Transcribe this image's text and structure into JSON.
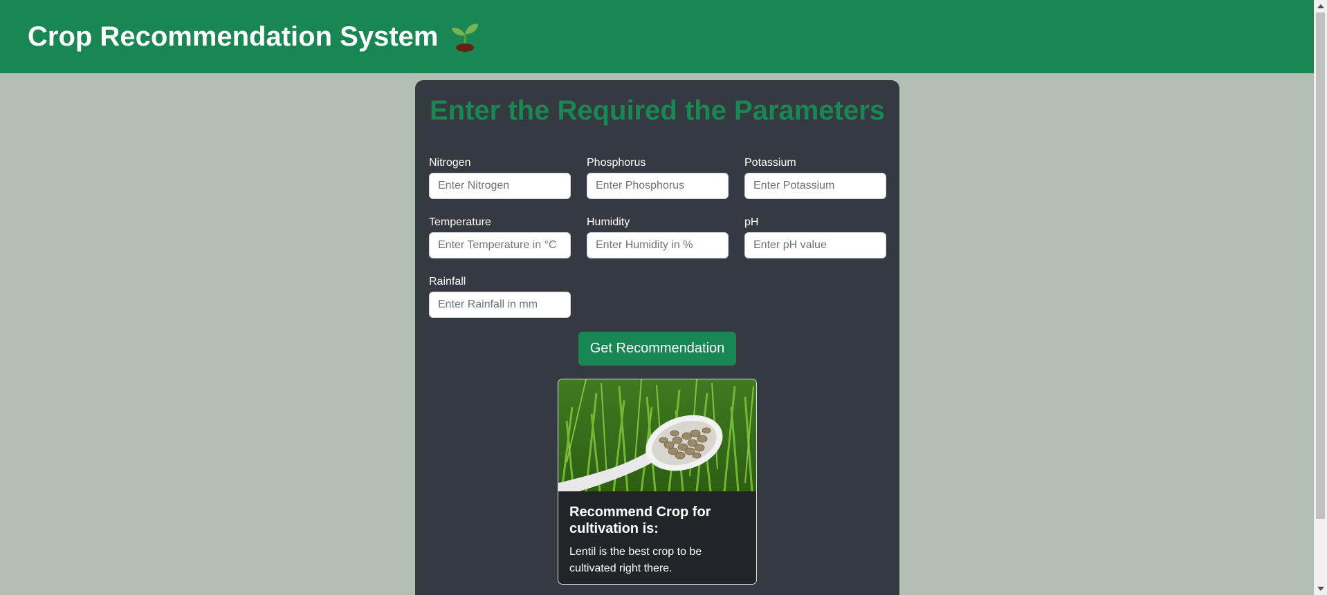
{
  "navbar": {
    "title": "Crop Recommendation System",
    "icon": "seedling-icon"
  },
  "form": {
    "heading": "Enter the Required the Parameters",
    "fields": [
      {
        "label": "Nitrogen",
        "placeholder": "Enter Nitrogen",
        "value": ""
      },
      {
        "label": "Phosphorus",
        "placeholder": "Enter Phosphorus",
        "value": ""
      },
      {
        "label": "Potassium",
        "placeholder": "Enter Potassium",
        "value": ""
      },
      {
        "label": "Temperature",
        "placeholder": "Enter Temperature in °C",
        "value": ""
      },
      {
        "label": "Humidity",
        "placeholder": "Enter Humidity in %",
        "value": ""
      },
      {
        "label": "pH",
        "placeholder": "Enter pH value",
        "value": ""
      },
      {
        "label": "Rainfall",
        "placeholder": "Enter Rainfall in mm",
        "value": ""
      }
    ],
    "submit_label": "Get Recommendation"
  },
  "result": {
    "image": "lentil-seeds-image",
    "title": "Recommend Crop for cultivation is:",
    "text": "Lentil is the best crop to be cultivated right there."
  },
  "colors": {
    "accent": "#198754",
    "page_background": "#b3bfb3",
    "panel_background": "#343a40",
    "card_background": "#212529"
  }
}
